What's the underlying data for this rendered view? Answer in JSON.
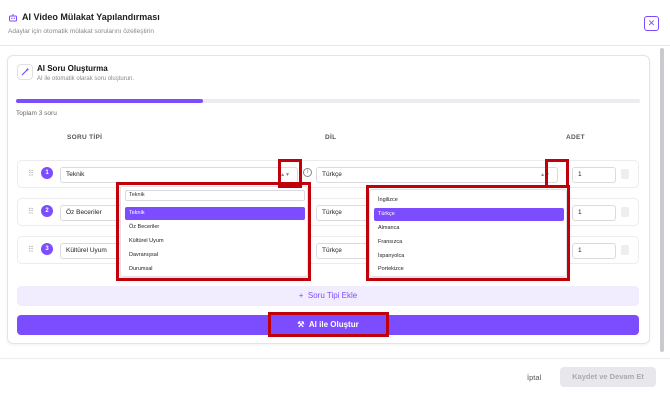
{
  "header": {
    "title": "AI Video Mülakat Yapılandırması",
    "subtitle": "Adaylar için otomatik mülakat sorularını özelleştirin",
    "close_symbol": "✕"
  },
  "card": {
    "title": "AI Soru Oluşturma",
    "subtitle": "AI ile otomatik olarak soru oluşturun.",
    "progress_fraction": 0.3,
    "total_label": "Toplam 3 soru"
  },
  "columns": {
    "type": "SORU TİPİ",
    "lang": "DİL",
    "count": "ADET"
  },
  "rows": [
    {
      "num": "1",
      "type": "Teknik",
      "lang": "Türkçe",
      "count": "1"
    },
    {
      "num": "2",
      "type": "Öz Beceriler",
      "lang": "Türkçe",
      "count": "1"
    },
    {
      "num": "3",
      "type": "Kültürel Uyum",
      "lang": "Türkçe",
      "count": "1"
    }
  ],
  "type_dropdown": {
    "search_value": "Teknik",
    "options": [
      "Teknik",
      "Öz Beceriler",
      "Kültürel Uyum",
      "Davranışsal",
      "Durumsal"
    ],
    "selected": "Teknik"
  },
  "lang_dropdown": {
    "options": [
      "İngilizce",
      "Türkçe",
      "Almanca",
      "Fransızca",
      "İspanyolca",
      "Portekizce"
    ],
    "selected": "Türkçe"
  },
  "buttons": {
    "add": "Soru Tipi Ekle",
    "add_symbol": "+",
    "generate": "AI ile Oluştur",
    "cancel": "İptal",
    "save": "Kaydet ve Devam Et"
  },
  "icons": {
    "header": "robot-icon",
    "card": "magic-wand-icon",
    "close": "close-icon",
    "drag": "drag-handle-icon",
    "info": "info-icon",
    "delete": "trash-icon",
    "chevron": "chevron-updown-icon"
  },
  "colors": {
    "accent": "#7c4dff",
    "highlight_box": "#c0000b"
  }
}
